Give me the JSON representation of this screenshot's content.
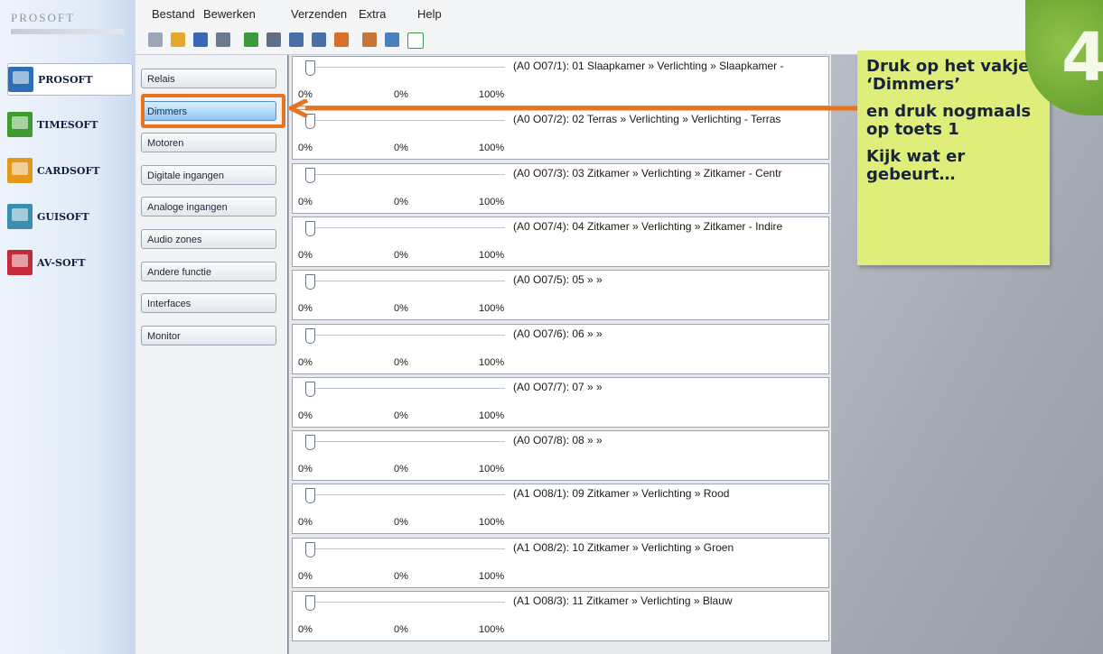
{
  "brand": {
    "logo_text": "PROSOFT"
  },
  "apps": [
    {
      "label": "PROSOFT",
      "icon": "house-icon",
      "color": "#2f6fb5",
      "active": true
    },
    {
      "label": "TIMESOFT",
      "icon": "clock-icon",
      "color": "#3f9b2f",
      "active": false
    },
    {
      "label": "CARDSOFT",
      "icon": "card-icon",
      "color": "#e39a1c",
      "active": false
    },
    {
      "label": "GUISOFT",
      "icon": "screen-icon",
      "color": "#3a8fb0",
      "active": false
    },
    {
      "label": "AV-SOFT",
      "icon": "speaker-icon",
      "color": "#c42a3a",
      "active": false
    }
  ],
  "menu": [
    "Bestand",
    "Bewerken",
    "Verzenden",
    "Extra",
    "Help"
  ],
  "toolbar_icons": [
    "new-file-icon",
    "open-folder-icon",
    "save-icon",
    "print-icon",
    "binoculars-icon",
    "grid-icon",
    "import-icon",
    "export-icon",
    "function-icon",
    "brush-icon",
    "tree-icon",
    "monitor-pulse-icon"
  ],
  "functions": [
    {
      "label": "Relais",
      "selected": false
    },
    {
      "label": "Dimmers",
      "selected": true
    },
    {
      "label": "Motoren",
      "selected": false
    },
    {
      "label": "Digitale ingangen",
      "selected": false
    },
    {
      "label": "Analoge ingangen",
      "selected": false
    },
    {
      "label": "Audio zones",
      "selected": false
    },
    {
      "label": "Andere functie",
      "selected": false
    },
    {
      "label": "Interfaces",
      "selected": false
    },
    {
      "label": "Monitor",
      "selected": false
    }
  ],
  "dimmers": [
    {
      "label": "(A0  O07/1):  01  Slaapkamer » Verlichting » Slaapkamer -",
      "level": "0%",
      "value": "0%",
      "max": "100%"
    },
    {
      "label": "(A0  O07/2):  02  Terras » Verlichting » Verlichting - Terras",
      "level": "0%",
      "value": "0%",
      "max": "100%"
    },
    {
      "label": "(A0  O07/3):  03  Zitkamer » Verlichting » Zitkamer - Centr",
      "level": "0%",
      "value": "0%",
      "max": "100%"
    },
    {
      "label": "(A0  O07/4):  04  Zitkamer » Verlichting » Zitkamer - Indire",
      "level": "0%",
      "value": "0%",
      "max": "100%"
    },
    {
      "label": "(A0  O07/5):  05  »  »",
      "level": "0%",
      "value": "0%",
      "max": "100%"
    },
    {
      "label": "(A0  O07/6):  06  »  »",
      "level": "0%",
      "value": "0%",
      "max": "100%"
    },
    {
      "label": "(A0  O07/7):  07  »  »",
      "level": "0%",
      "value": "0%",
      "max": "100%"
    },
    {
      "label": "(A0  O07/8):  08  »  »",
      "level": "0%",
      "value": "0%",
      "max": "100%"
    },
    {
      "label": "(A1  O08/1):  09  Zitkamer » Verlichting » Rood",
      "level": "0%",
      "value": "0%",
      "max": "100%"
    },
    {
      "label": "(A1  O08/2):  10  Zitkamer » Verlichting » Groen",
      "level": "0%",
      "value": "0%",
      "max": "100%"
    },
    {
      "label": "(A1  O08/3):  11  Zitkamer » Verlichting » Blauw",
      "level": "0%",
      "value": "0%",
      "max": "100%"
    }
  ],
  "callout": {
    "line1": "Druk op het vakje ‘Dimmers’",
    "line2": "en druk nogmaals op toets 1",
    "line3": "Kijk wat er gebeurt…"
  },
  "step_number": "4",
  "colors": {
    "highlight": "#e8741e",
    "callout_bg": "#dfee7a",
    "badge": "#6aa832",
    "selected_button": "#8fc7f3"
  }
}
